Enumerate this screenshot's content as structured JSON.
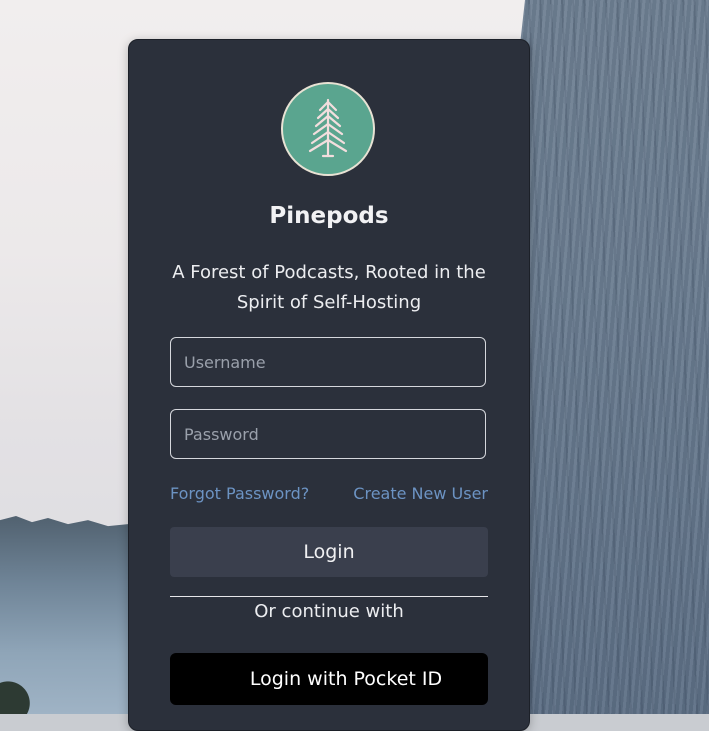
{
  "app": {
    "name": "Pinepods",
    "tagline": "A Forest of Podcasts, Rooted in the Spirit of Self-Hosting",
    "logo_icon": "pine-tree-icon",
    "logo_color": "#5aa58f"
  },
  "form": {
    "username_placeholder": "Username",
    "username_value": "",
    "password_placeholder": "Password",
    "password_value": ""
  },
  "links": {
    "forgot_password": "Forgot Password?",
    "create_user": "Create New User"
  },
  "buttons": {
    "login": "Login",
    "continue_text": "Or continue with",
    "pocket_id": "Login with Pocket ID"
  },
  "colors": {
    "card_bg": "#2b303b",
    "link": "#6c93c3",
    "login_button_bg": "#3a3f4d",
    "pocket_button_bg": "#000000"
  }
}
